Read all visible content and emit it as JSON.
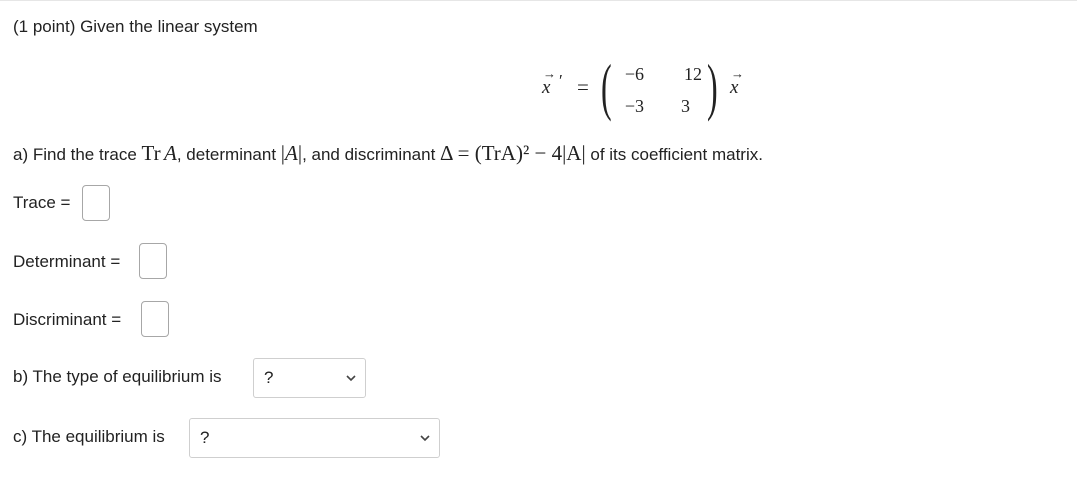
{
  "problem": {
    "intro": "(1 point) Given the linear system",
    "matrix": [
      [
        "−6",
        "12"
      ],
      [
        "−3",
        "3"
      ]
    ],
    "vector_symbol": "x",
    "part_a": {
      "prefix": "a) Find the trace ",
      "trace_notation": "Tr",
      "matrix_symbol": "A",
      "mid1": ", determinant ",
      "mid2": ", and discriminant ",
      "formula": "Δ = (TrA)² − 4|A|",
      "suffix": " of its coefficient matrix."
    },
    "inputs": {
      "trace_label": "Trace =",
      "trace_value": "",
      "determinant_label": "Determinant =",
      "determinant_value": "",
      "discriminant_label": "Discriminant =",
      "discriminant_value": ""
    },
    "part_b": {
      "label": "b) The type of equilibrium is",
      "selected": "?"
    },
    "part_c": {
      "label": "c) The equilibrium is",
      "selected": "?"
    }
  }
}
